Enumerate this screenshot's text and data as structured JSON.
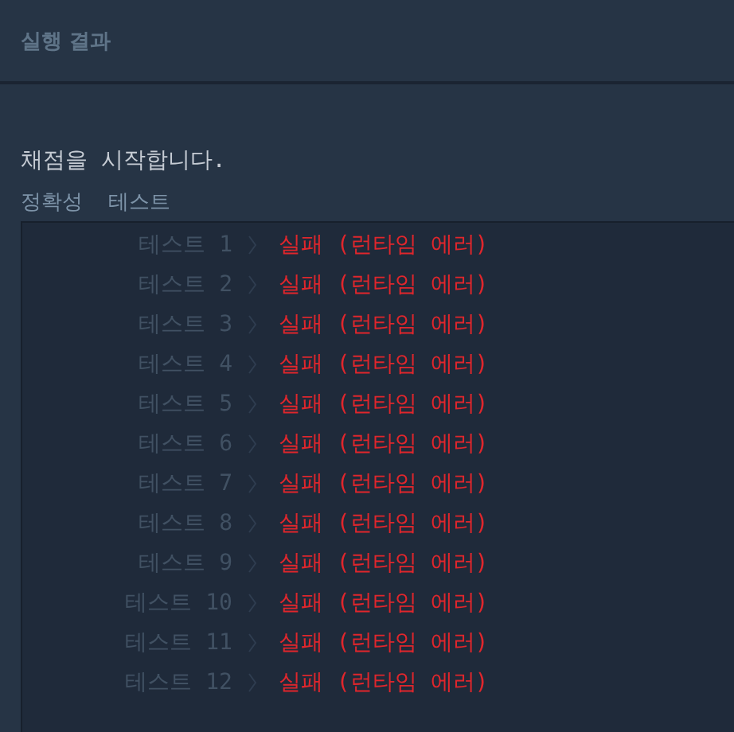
{
  "header": {
    "title": "실행 결과"
  },
  "console": {
    "message": "채점을 시작합니다.",
    "tabs": [
      {
        "label": "정확성"
      },
      {
        "label": "테스트"
      }
    ],
    "rows": [
      {
        "label": "테스트 1",
        "result": "실패 (런타임 에러)"
      },
      {
        "label": "테스트 2",
        "result": "실패 (런타임 에러)"
      },
      {
        "label": "테스트 3",
        "result": "실패 (런타임 에러)"
      },
      {
        "label": "테스트 4",
        "result": "실패 (런타임 에러)"
      },
      {
        "label": "테스트 5",
        "result": "실패 (런타임 에러)"
      },
      {
        "label": "테스트 6",
        "result": "실패 (런타임 에러)"
      },
      {
        "label": "테스트 7",
        "result": "실패 (런타임 에러)"
      },
      {
        "label": "테스트 8",
        "result": "실패 (런타임 에러)"
      },
      {
        "label": "테스트 9",
        "result": "실패 (런타임 에러)"
      },
      {
        "label": "테스트 10",
        "result": "실패 (런타임 에러)"
      },
      {
        "label": "테스트 11",
        "result": "실패 (런타임 에러)"
      },
      {
        "label": "테스트 12",
        "result": "실패 (런타임 에러)"
      }
    ]
  }
}
